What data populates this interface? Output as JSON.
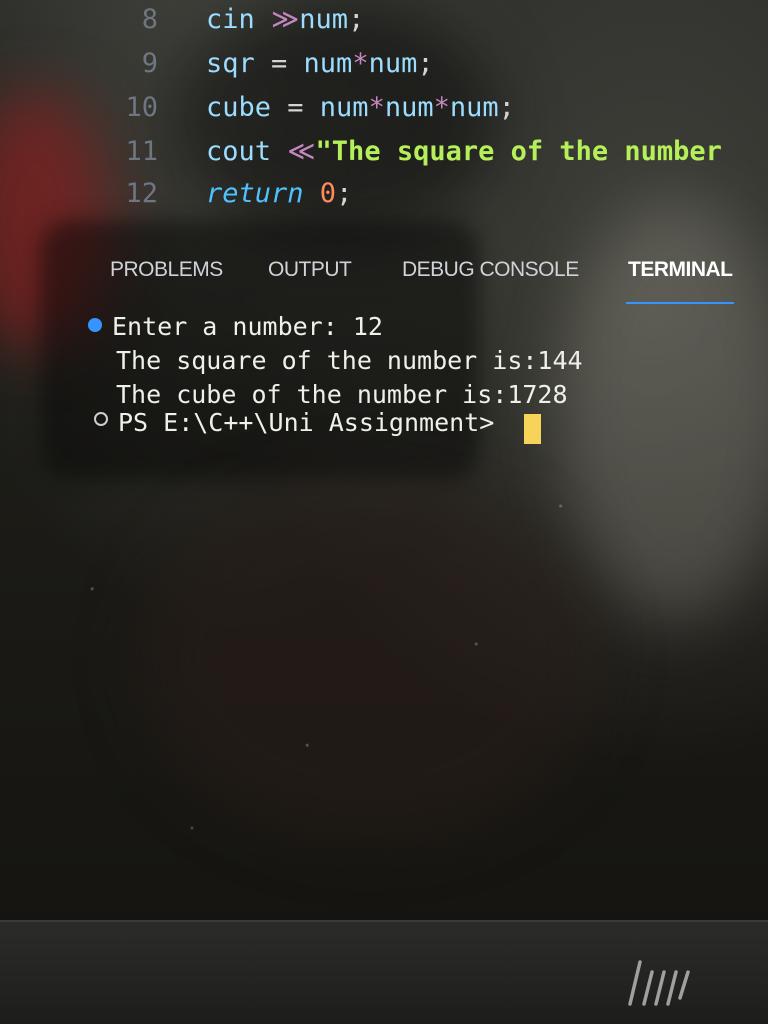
{
  "code": {
    "lines": [
      {
        "num": "8",
        "tokens": [
          {
            "t": "cin ",
            "c": "var"
          },
          {
            "t": "≫",
            "c": "io"
          },
          {
            "t": "num",
            "c": "var"
          },
          {
            "t": ";",
            "c": "punct"
          }
        ]
      },
      {
        "num": "9",
        "tokens": [
          {
            "t": "sqr ",
            "c": "var"
          },
          {
            "t": "= ",
            "c": "op"
          },
          {
            "t": "num",
            "c": "var"
          },
          {
            "t": "*",
            "c": "io"
          },
          {
            "t": "num",
            "c": "var"
          },
          {
            "t": ";",
            "c": "punct"
          }
        ]
      },
      {
        "num": "10",
        "tokens": [
          {
            "t": "cube ",
            "c": "var"
          },
          {
            "t": "= ",
            "c": "op"
          },
          {
            "t": "num",
            "c": "var"
          },
          {
            "t": "*",
            "c": "io"
          },
          {
            "t": "num",
            "c": "var"
          },
          {
            "t": "*",
            "c": "io"
          },
          {
            "t": "num",
            "c": "var"
          },
          {
            "t": ";",
            "c": "punct"
          }
        ]
      },
      {
        "num": "11",
        "tokens": [
          {
            "t": "cout ",
            "c": "var"
          },
          {
            "t": "≪",
            "c": "io"
          },
          {
            "t": "\"The square of the number",
            "c": "str"
          }
        ]
      },
      {
        "num": "12",
        "tokens": [
          {
            "t": "return ",
            "c": "kw"
          },
          {
            "t": "0",
            "c": "num"
          },
          {
            "t": ";",
            "c": "punct"
          }
        ]
      }
    ]
  },
  "panel": {
    "tabs": [
      {
        "label": "PROBLEMS",
        "active": false
      },
      {
        "label": "OUTPUT",
        "active": false
      },
      {
        "label": "DEBUG CONSOLE",
        "active": false
      },
      {
        "label": "TERMINAL",
        "active": true
      }
    ]
  },
  "terminal": {
    "lines": [
      "Enter a number: 12",
      "The square of the number is:144",
      "The cube of the number is:1728",
      "PS E:\\C++\\Uni Assignment> "
    ]
  },
  "colors": {
    "accent": "#3794ff",
    "cursor": "#f7d35a",
    "string": "#b5f05a",
    "keyword": "#4fc1ff"
  },
  "icons": [
    "command-success-dot-icon",
    "command-pending-dot-icon",
    "hp-logo-icon"
  ]
}
